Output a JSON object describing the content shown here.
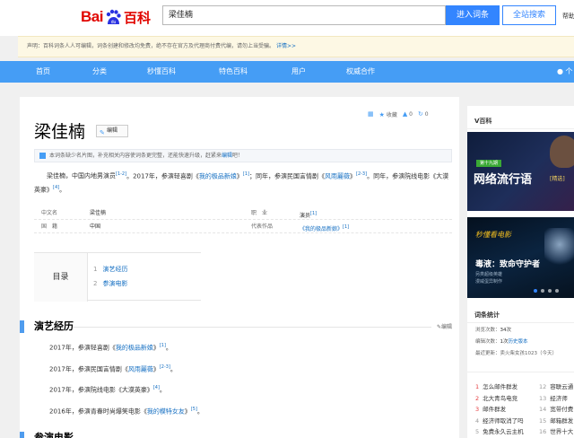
{
  "header": {
    "logo_bai": "Bai",
    "logo_du": "du",
    "logo_ke": "百科",
    "search_value": "梁佳楠",
    "enter_button": "进入词条",
    "site_search_button": "全站搜索",
    "help_link": "帮助"
  },
  "notice": {
    "text": "声明：百科词条人人可编辑，词条创建和修改均免费，绝不存在官方及代理商付费代编，请勿上当受骗。",
    "detail_link": "详情>>"
  },
  "nav": {
    "items": [
      "首页",
      "分类",
      "秒懂百科",
      "特色百科",
      "用户",
      "权威合作"
    ],
    "user": "个"
  },
  "toolbar": {
    "collect": "收藏",
    "like_count": "0",
    "share_count": "0"
  },
  "entry": {
    "title": "梁佳楠",
    "edit_label": "编辑",
    "tip_text": "本词条缺少名片图，补充相关内容使词条更完整，还能快速升级，赶紧来",
    "tip_link": "编辑",
    "tip_end": "吧！",
    "para_1": "梁佳楠，中国内地男演员",
    "para_1_ref": "[1-2]",
    "para_2": "。2017年，参演轻喜剧《",
    "para_2_link": "我的极品新娘",
    "para_2_end": "》",
    "para_2_ref": "[1]",
    "para_3": "；同年，参演民国言情剧《",
    "para_3_link": "风雨麗薇",
    "para_3_end": "》",
    "para_3_ref": "[2-3]",
    "para_4": "。同年，参演院线电影《大漠英豪》",
    "para_4_ref": "[4]",
    "para_4_end": "。"
  },
  "basic_info": {
    "row1": {
      "k1": "中文名",
      "v1": "梁佳楠",
      "k2": "职　业",
      "v2": "演员",
      "v2_ref": "[1]"
    },
    "row2": {
      "k1": "国　籍",
      "v1": "中国",
      "k2": "代表作品",
      "v2": "《我的极品新娘》",
      "v2_ref": "[1]"
    }
  },
  "toc": {
    "label": "目录",
    "items": [
      {
        "num": "1",
        "text": "演艺经历"
      },
      {
        "num": "2",
        "text": "参演电影"
      }
    ]
  },
  "section1": {
    "title": "演艺经历",
    "edit": "编辑",
    "entries": [
      {
        "pre": "2017年，参演轻喜剧《",
        "link": "我的极品新娘",
        "post": "》",
        "ref": "[1]",
        "end": "。"
      },
      {
        "pre": "2017年，参演民国言情剧《",
        "link": "风雨麗薇",
        "post": "》",
        "ref": "[2-3]",
        "end": "。"
      },
      {
        "pre": "2017年，参演院线电影《大漠英豪》",
        "link": "",
        "post": "",
        "ref": "[4]",
        "end": "。"
      },
      {
        "pre": "2016年，参演青春时尚爆笑电影《",
        "link": "我的模特女友",
        "post": "》",
        "ref": "[5]",
        "end": "。"
      }
    ]
  },
  "section2": {
    "title": "参演电影"
  },
  "sidebar": {
    "vbaike": "V百科",
    "banner1_tag": "第十九期",
    "banner1_title": "网络流行语",
    "banner1_sub": "[精选]",
    "banner2_brand_a": "秒懂",
    "banner2_brand_b": "看电影",
    "banner2_title": "毒液：致命守护者",
    "banner2_line1": "另类超级英雄",
    "banner2_line2": "漫威蛋异制作",
    "stats_title": "词条统计",
    "stats_views_label": "浏览次数：",
    "stats_views": "34次",
    "stats_edits_label": "编辑次数：",
    "stats_edits": "1次",
    "stats_history": "历史版本",
    "stats_update": "最近更新：卖火柴女孩1023（今天）",
    "hot": [
      {
        "n": "1",
        "t": "怎么邮件群发"
      },
      {
        "n": "2",
        "t": "北大青鸟电竞"
      },
      {
        "n": "3",
        "t": "邮件群发"
      },
      {
        "n": "4",
        "t": "经济师取消了吗"
      },
      {
        "n": "5",
        "t": "免费永久云主机"
      }
    ],
    "hot2": [
      {
        "n": "12",
        "t": "容联云通"
      },
      {
        "n": "13",
        "t": "经济师"
      },
      {
        "n": "14",
        "t": "宽带付费"
      },
      {
        "n": "15",
        "t": "邮箱群发"
      },
      {
        "n": "16",
        "t": "世界十大"
      }
    ]
  }
}
